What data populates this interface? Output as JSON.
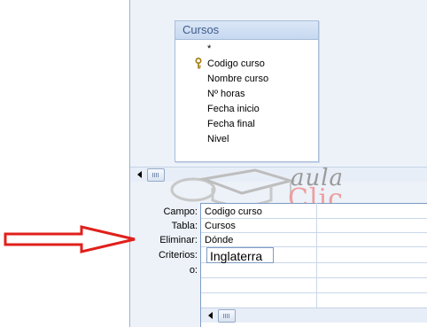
{
  "field_list": {
    "title": "Cursos",
    "fields": [
      {
        "label": "*",
        "key": false
      },
      {
        "label": "Codigo curso",
        "key": true
      },
      {
        "label": "Nombre curso",
        "key": false
      },
      {
        "label": "Nº horas",
        "key": false
      },
      {
        "label": "Fecha inicio",
        "key": false
      },
      {
        "label": "Fecha final",
        "key": false
      },
      {
        "label": "Nivel",
        "key": false
      }
    ],
    "key_icon": "key-icon"
  },
  "watermark": {
    "word1": "aula",
    "word2": "Clic",
    "colors": {
      "gray": "#9a9a9a",
      "pink": "#ef9e9e"
    }
  },
  "grid": {
    "row_labels": {
      "campo": "Campo:",
      "tabla": "Tabla:",
      "eliminar": "Eliminar:",
      "criterios": "Criterios:",
      "o": "o:"
    },
    "column1": {
      "campo": "Codigo curso",
      "tabla": "Cursos",
      "eliminar": "Dónde",
      "criterios": "Inglaterra"
    }
  },
  "annotation": {
    "arrow_color": "#e0201b",
    "arrow_icon": "right-arrow-icon"
  },
  "accent": "#7f9cc4"
}
